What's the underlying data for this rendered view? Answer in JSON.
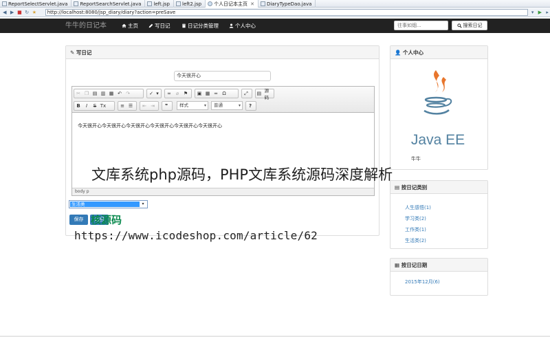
{
  "ide_tabs": [
    {
      "label": "ReportSelectServlet.java"
    },
    {
      "label": "ReportSearchServlet.java"
    },
    {
      "label": "left.jsp"
    },
    {
      "label": "left2.jsp"
    },
    {
      "label": "个人日记本主页"
    },
    {
      "label": "DiaryTypeDao.java"
    }
  ],
  "ide_tab_close": "✕",
  "browser": {
    "url": "http://localhost:8080/jsp_diary/diary?action=preSave"
  },
  "navbar": {
    "brand": "牛牛的日记本",
    "home": "主页",
    "write": "写日记",
    "category_manage": "日记分类管理",
    "user_center": "个人中心",
    "search_placeholder": "往事如烟...",
    "search_button": "搜索日记"
  },
  "write_panel": {
    "title": "写日记",
    "title_value": "今天很开心",
    "content": "今天很开心今天很开心今天很开心今天很开心今天很开心今天很开心",
    "statusbar": "body  p",
    "source_label": "源码",
    "format_label": "样式",
    "paragraph_label": "普通",
    "category_selected": "生活类",
    "submit_label": "保存",
    "reset_label": "返回"
  },
  "user_panel": {
    "title": "个人中心",
    "logo_text": "Java EE",
    "username": "牛牛"
  },
  "type_panel": {
    "title": "按日记类别",
    "items": [
      "人生感悟(1)",
      "学习类(2)",
      "工作类(1)",
      "生活类(2)"
    ]
  },
  "date_panel": {
    "title": "按日记日期",
    "items": [
      "2015年12月(6)"
    ]
  },
  "overlays": {
    "headline": "文库系统php源码，PHP文库系统源码深度解析",
    "brand": "核源码",
    "url": "https://www.icodeshop.com/article/62"
  },
  "colors": {
    "navbar": "#222222",
    "primary": "#337ab7",
    "select_highlight": "#3399ff",
    "java_orange": "#e8762d",
    "java_blue": "#5382a1"
  }
}
